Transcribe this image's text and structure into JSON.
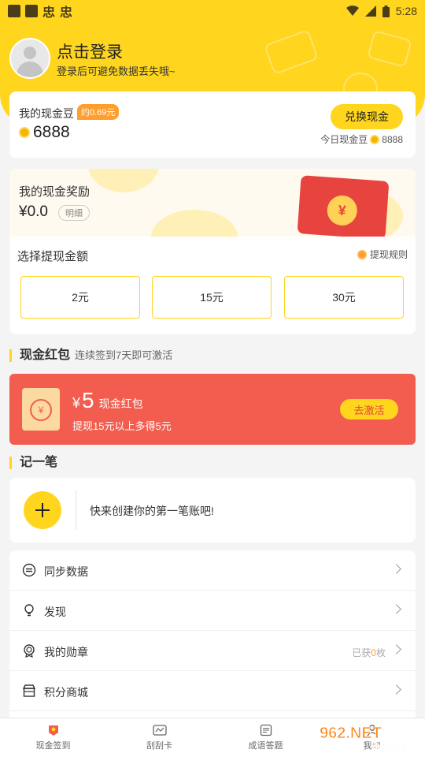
{
  "status_bar": {
    "time": "5:28",
    "left_glyphs": [
      "忠",
      "忠"
    ]
  },
  "header": {
    "title": "点击登录",
    "subtitle": "登录后可避免数据丢失哦~"
  },
  "coin_card": {
    "label": "我的现金豆",
    "badge": "约0.69元",
    "value": "6888",
    "exchange_button": "兑换现金",
    "today_label": "今日现金豆",
    "today_value": "8888"
  },
  "reward_card": {
    "title": "我的现金奖励",
    "value": "¥0.0",
    "detail_button": "明细",
    "choose_label": "选择提现金额",
    "rules_link": "提现规则",
    "amounts": [
      "2元",
      "15元",
      "30元"
    ]
  },
  "red_packet_section": {
    "title": "现金红包",
    "subtitle": "连续签到7天即可激活",
    "currency": "¥",
    "amount": "5",
    "unit": "现金红包",
    "desc": "提现15元以上多得5元",
    "button": "去激活"
  },
  "note_section": {
    "title": "记一笔",
    "prompt": "快来创建你的第一笔账吧!"
  },
  "menu": [
    {
      "label": "同步数据",
      "icon": "sync-icon"
    },
    {
      "label": "发现",
      "icon": "bulb-icon"
    },
    {
      "label": "我的勋章",
      "icon": "medal-icon",
      "extra_prefix": "已获",
      "extra_count": "0",
      "extra_suffix": "枚"
    },
    {
      "label": "积分商城",
      "icon": "shop-icon"
    }
  ],
  "tabs": [
    {
      "label": "现金签到",
      "icon": "cash-signin-icon"
    },
    {
      "label": "刮刮卡",
      "icon": "scratch-card-icon"
    },
    {
      "label": "成语答题",
      "icon": "idiom-quiz-icon"
    },
    {
      "label": "我的",
      "icon": "profile-icon"
    }
  ],
  "watermark": {
    "brand": "962.NET",
    "site": "乐游网"
  },
  "colors": {
    "accent": "#ffd51e",
    "red": "#f25d4f",
    "orange": "#ff9e2c"
  }
}
